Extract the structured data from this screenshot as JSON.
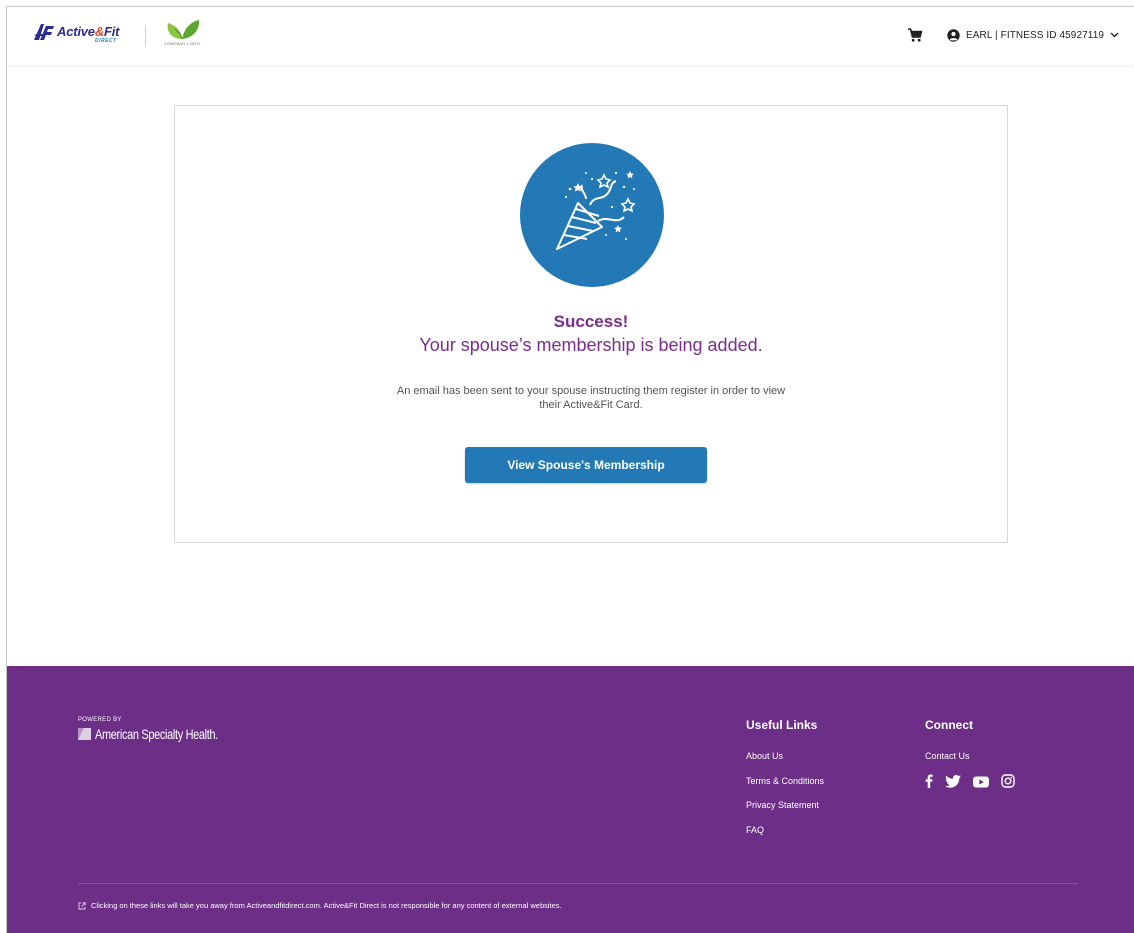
{
  "header": {
    "logo": {
      "name": "Active&Fit",
      "sub": "DIRECT",
      "icon": "active-fit-logo-icon"
    },
    "company_logo": {
      "label": "COMPANY LOGO",
      "icon": "leaf-logo-icon"
    },
    "cart_icon": "shopping-cart-icon",
    "user": {
      "icon": "user-circle-icon",
      "label": "EARL | FITNESS ID 45927119",
      "chevron": "chevron-down-icon"
    }
  },
  "success": {
    "illustration": "party-popper-icon",
    "title": "Success!",
    "subtitle": "Your spouse’s membership is being added.",
    "message": "An email has been sent to your spouse instructing them register in order to view their Active&Fit Card.",
    "button_label": "View Spouse's Membership"
  },
  "footer": {
    "powered_by": "POWERED BY",
    "company": "American Specialty Health.",
    "useful_links": {
      "title": "Useful Links",
      "links": [
        "About Us",
        "Terms & Conditions",
        "Privacy Statement",
        "FAQ"
      ]
    },
    "connect": {
      "title": "Connect",
      "contact": "Contact Us",
      "social": [
        "facebook-icon",
        "twitter-icon",
        "youtube-icon",
        "instagram-icon"
      ]
    },
    "disclaimer": "Clicking on these links will take you away from Activeandfitdirect.com. Active&Fit Direct is not responsible for any content of external websites.",
    "disclaimer_icon": "external-link-icon"
  },
  "colors": {
    "brand_purple": "#6c2e87",
    "accent_purple": "#7b2c8e",
    "primary_blue": "#2279b5"
  }
}
